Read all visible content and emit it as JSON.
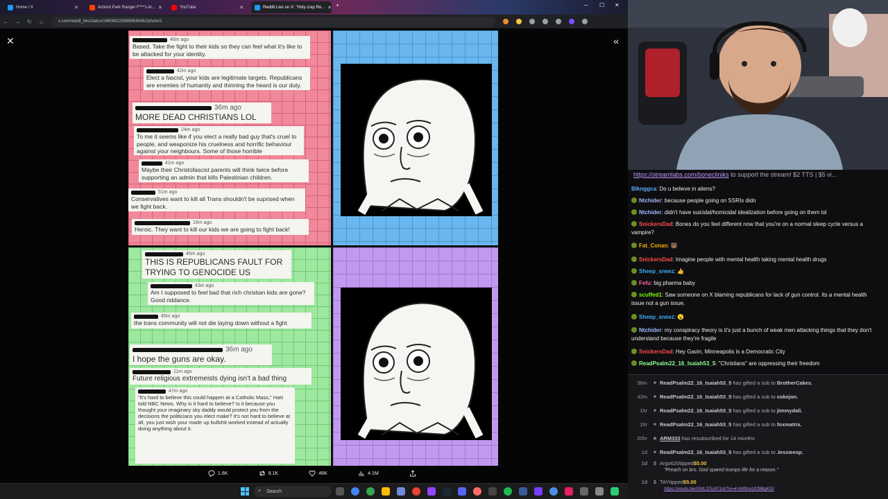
{
  "browser": {
    "tabs": [
      {
        "label": "Home / X",
        "active": false,
        "color": "#1d9bf0"
      },
      {
        "label": "Activist Park Ranger F***'s Ar...",
        "active": false,
        "color": "#ff4500"
      },
      {
        "label": "YouTube",
        "active": false,
        "color": "#ff0000"
      },
      {
        "label": "Reddit Lies on X: \"Holy crap Re...",
        "active": true,
        "color": "#1d9bf0"
      }
    ],
    "new_tab": "+",
    "window_controls": [
      "─",
      "☐",
      "✕"
    ],
    "url": "x.com/reddit_lies/status/1960832258899636462/photo/1",
    "nav": {
      "back": "←",
      "forward": "→",
      "reload": "↻",
      "home": "⌂"
    }
  },
  "viewer": {
    "close_icon": "✕",
    "collapse_icon": "«"
  },
  "meme": {
    "red_comments": [
      {
        "time": "46m ago",
        "text": "Based. Take the fight to their kids so they can feel what it's like to be attacked for your identity."
      },
      {
        "time": "42m ago",
        "text": "Elect a fascist, your kids are legitimate targets. Republicans are enemies of humanity and thinning the heard is our duty."
      },
      {
        "time": "36m ago",
        "text": "MORE DEAD CHRISTIANS LOL"
      },
      {
        "time": "24m ago",
        "text": "To me it seems like if you elect a really bad guy that's cruel to people, and weaponize his cruelness and horrific behaviour against your neighbours. Some of those horrible"
      },
      {
        "time": "41m ago",
        "text": "Maybe their Christofascist parents will think twice before supporting an admin that kills Palestinian children."
      },
      {
        "time": "51m ago",
        "text": "Conservatives want to kill all Trans shouldn't be suprised when we fight back."
      },
      {
        "time": "16m ago",
        "text": "Heroic. They want to kill our kids we are going to fight back!"
      }
    ],
    "green_comments": [
      {
        "time": "46m ago",
        "text": "THIS IS REPUBLICANS FAULT FOR TRYING TO GENOCIDE US"
      },
      {
        "time": "43m ago",
        "text": "Am I supposed to feel bad that rich christian kids are gone? Good riddance."
      },
      {
        "time": "45m ago",
        "text": "the trans community will not die laying down without a fight"
      },
      {
        "time": "36m ago",
        "text": "I hope the guns are okay."
      },
      {
        "time": "11m ago",
        "text": "Future religious extremeists dying isn't a bad thing"
      },
      {
        "time": "47m ago",
        "text": "\"It's hard to believe this could happen at a Catholic Mass,\" Hart told NBC News. Why is it hard to believe? Is it because you thought your imaginary sky daddy would protect you from the decisions the politicians you elect make? It's not hard to believe at all, you just wish your made up bullshit worked instead of actually doing anything about it."
      }
    ]
  },
  "tweet_actions": {
    "replies": "1.6K",
    "reposts": "8.1K",
    "likes": "46K",
    "views": "4.1M"
  },
  "taskbar": {
    "search_placeholder": "Search"
  },
  "chat": {
    "ticker_link": "https://streamlabs.com/bonecliniks",
    "ticker_text": " to support the stream! $2 TTS | $5 vi...",
    "messages": [
      {
        "user": "Blknggca",
        "color": "#5aa9ff",
        "text": "Do u believe in aliens?",
        "badge": false
      },
      {
        "user": "Ntchider",
        "color": "#a0b8ff",
        "text": "because people going on SSRIs didn",
        "badge": true
      },
      {
        "user": "Ntchider",
        "color": "#a0b8ff",
        "text": "didn't have suicidal/homicidal idealization before going on them lol",
        "badge": true
      },
      {
        "user": "SnickersDad",
        "color": "#ff4d4d",
        "text": "Bones do you feel different now that you're on a normal sleep cycle versus a vampire?",
        "badge": true
      },
      {
        "user": "Fat_Conan",
        "color": "#ffb000",
        "text": "🐻",
        "badge": true
      },
      {
        "user": "SnickersDad",
        "color": "#ff4d4d",
        "text": "Imagine people with mental health taking mental health drugs",
        "badge": true
      },
      {
        "user": "Sheep_sneez",
        "color": "#3fa9f5",
        "text": "👍",
        "badge": true
      },
      {
        "user": "Fefu",
        "color": "#ff5fb0",
        "text": "big pharma baby",
        "badge": true
      },
      {
        "user": "scuffed1",
        "color": "#7cfc00",
        "text": "Saw someone on X blaming republicans for lack of gun control. Its a mental health issue not a gun issue.",
        "badge": true
      },
      {
        "user": "Sheep_sneez",
        "color": "#3fa9f5",
        "text": "😮",
        "badge": true
      },
      {
        "user": "Ntchider",
        "color": "#a0b8ff",
        "text": "my conspiracy theory is it's just a bunch of weak men attacking things that they don't understand because they're fragile",
        "badge": true
      },
      {
        "user": "SnickersDad",
        "color": "#ff4d4d",
        "text": "Hey Gavin, Minneapolis is a Democratic City",
        "badge": true
      },
      {
        "user": "ReadPsalm22_16_Isaiah53_5",
        "color": "#8fff8f",
        "text": "\"Christians\" are oppressing their freedom",
        "badge": true
      }
    ],
    "events": [
      {
        "time": "36m",
        "who": "ReadPsalm22_16_Isaiah53_5",
        "mid": " has gifted a sub to ",
        "to": "BrotherCakes."
      },
      {
        "time": "42m",
        "who": "ReadPsalm22_16_Isaiah53_5",
        "mid": " has gifted a sub to ",
        "to": "cokejon."
      },
      {
        "time": "1hr",
        "who": "ReadPsalm22_16_Isaiah53_5",
        "mid": " has gifted a sub to ",
        "to": "jimmydali."
      },
      {
        "time": "1hr",
        "who": "ReadPsalm22_16_Isaiah53_5",
        "mid": " has gifted a sub to ",
        "to": "foxmatrix."
      },
      {
        "time": "20hr",
        "who": "ARM333",
        "mid": " has resubscribed for 14 months",
        "to": ""
      },
      {
        "time": "1d",
        "who": "ReadPsalm22_16_Isaiah53_5",
        "mid": " has gifted a sub to ",
        "to": "Jessieesp."
      }
    ],
    "tips": [
      {
        "time": "1d",
        "who": "Argo620",
        "amount": "$5.00",
        "note": "\"Preach on bro. God spared trumps life for a reason.\""
      },
      {
        "time": "1d",
        "who": "TAY",
        "amount": "$5.00",
        "note": "https://youtu.be/XWL3TuXF1AI?si=4-hM9syUfJ9BqKGI"
      }
    ],
    "tipped_word": " tipped "
  }
}
